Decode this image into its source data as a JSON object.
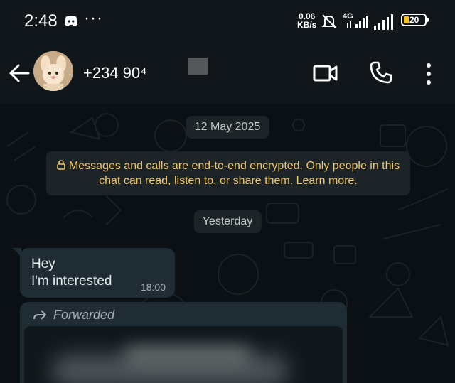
{
  "status_bar": {
    "time": "2:48",
    "more": "···",
    "speed_value": "0.06",
    "speed_unit": "KB/s",
    "network": "4G",
    "battery": "20",
    "battery_fraction": 0.2,
    "battery_color": "#f4c21a"
  },
  "header": {
    "contact_name": "+234 90⁴",
    "icons": [
      "back-arrow-icon",
      "avatar",
      "video-call-icon",
      "voice-call-icon",
      "more-options-icon"
    ]
  },
  "chat": {
    "date_chip": "12 May 2025",
    "encryption_notice": "Messages and calls are end-to-end encrypted. Only people in this chat can read, listen to, or share them. Learn more.",
    "day_chip": "Yesterday",
    "messages": [
      {
        "text": "Hey\nI'm interested",
        "time": "18:00"
      }
    ],
    "forwarded_label": "Forwarded"
  },
  "colors": {
    "background": "#0b1014",
    "header": "#101619",
    "bubble": "#1f2c33",
    "encryption_text": "#f1c86a"
  }
}
